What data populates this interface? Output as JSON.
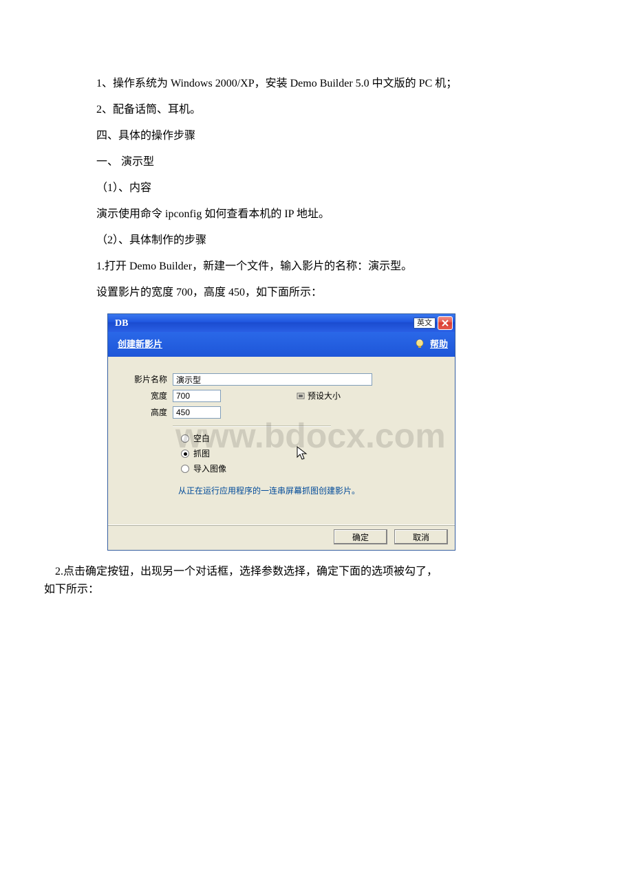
{
  "doc": {
    "p1": "1、操作系统为 Windows 2000/XP，安装 Demo Builder 5.0 中文版的 PC 机；",
    "p2": "2、配备话筒、耳机。",
    "p3": "四、具体的操作步骤",
    "p4": "一、 演示型",
    "p5": "（1）、内容",
    "p6": "演示使用命令 ipconfig 如何查看本机的 IP 地址。",
    "p7": "（2）、具体制作的步骤",
    "p8": "1.打开 Demo Builder，新建一个文件，输入影片的名称：演示型。",
    "p9": "设置影片的宽度 700，高度 450，如下面所示：",
    "p10a": "    2.点击确定按钮，出现另一个对话框，选择参数选择，确定下面的选项被勾了，",
    "p10b": "如下所示："
  },
  "dialog": {
    "title": "DB",
    "ime": "英文",
    "subheader": "创建新影片",
    "help": "帮助",
    "labels": {
      "name": "影片名称",
      "width": "宽度",
      "height": "高度",
      "preset": "预设大小"
    },
    "values": {
      "name": "演示型",
      "width": "700",
      "height": "450"
    },
    "radios": {
      "blank": "空白",
      "capture": "抓图",
      "import": "导入图像"
    },
    "hint": "从正在运行应用程序的一连串屏幕抓图创建影片。",
    "buttons": {
      "ok": "确定",
      "cancel": "取消"
    }
  },
  "watermark": "www.bdocx.com"
}
